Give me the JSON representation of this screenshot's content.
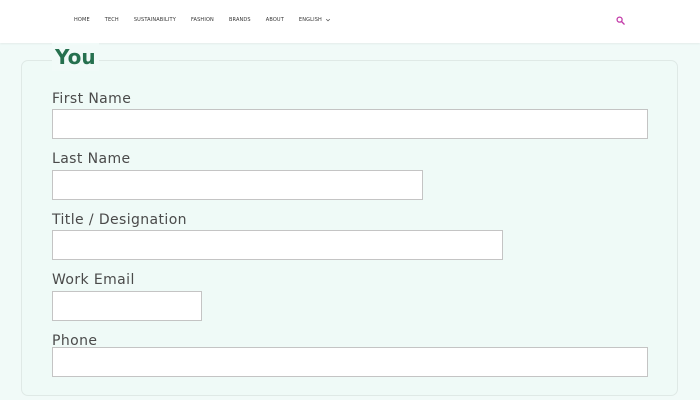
{
  "nav": {
    "items": [
      "HOME",
      "TECH",
      "SUSTAINABILITY",
      "FASHION",
      "BRANDS",
      "ABOUT"
    ],
    "language": "ENGLISH",
    "search_icon": "search-icon",
    "dropdown_icon": "chevron-down-icon"
  },
  "form": {
    "legend": "You",
    "fields": [
      {
        "label": "First Name",
        "value": "",
        "placeholder": ""
      },
      {
        "label": "Last Name",
        "value": "",
        "placeholder": ""
      },
      {
        "label": "Title / Designation",
        "value": "",
        "placeholder": ""
      },
      {
        "label": "Work Email",
        "value": "",
        "placeholder": ""
      },
      {
        "label": "Phone",
        "value": "",
        "placeholder": ""
      }
    ]
  },
  "colors": {
    "legend": "#26704f",
    "search_icon": "#c23aa8",
    "page_background": "#f1faf8"
  }
}
